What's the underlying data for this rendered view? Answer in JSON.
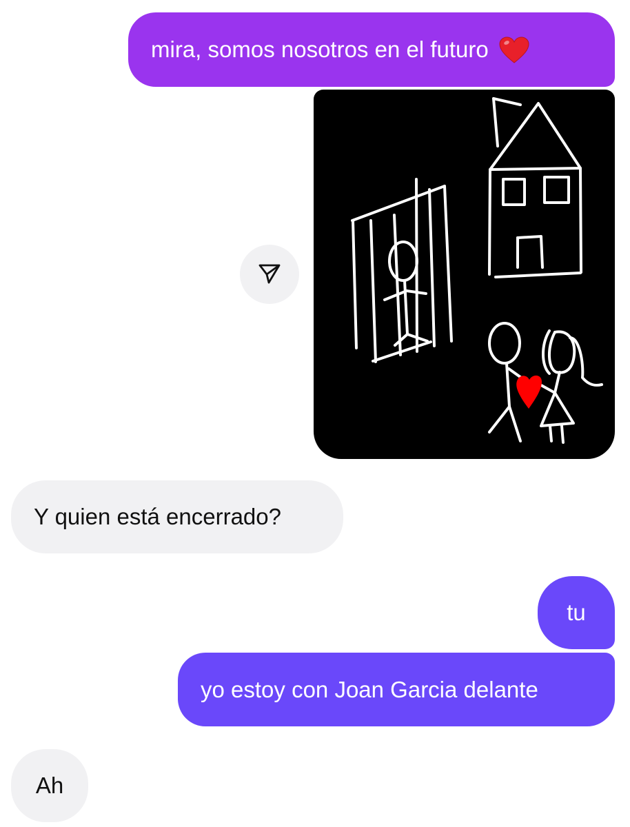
{
  "colors": {
    "sent_bubble_purple": "#9a34ee",
    "sent_bubble_violet": "#6a48fa",
    "received_bubble": "#f1f1f3",
    "drawing_background": "#000000",
    "drawing_stroke": "#ffffff",
    "drawing_heart": "#ff0000"
  },
  "messages": [
    {
      "from": "me",
      "text": "mira, somos nosotros en el futuro",
      "emoji": "❤️",
      "emoji_icon": "red-heart-icon"
    },
    {
      "from": "me",
      "type": "image",
      "content": "stick-figure-drawing",
      "action_icon": "send-share-icon"
    },
    {
      "from": "other",
      "text": "Y quien está encerrado?"
    },
    {
      "from": "me",
      "text": "tu"
    },
    {
      "from": "me",
      "text": "yo estoy con Joan Garcia delante"
    },
    {
      "from": "other",
      "text": "Ah"
    }
  ]
}
